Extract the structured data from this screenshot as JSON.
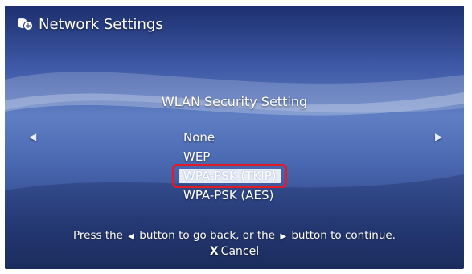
{
  "header": {
    "title": "Network Settings",
    "icon": "network-settings-icon"
  },
  "main": {
    "heading": "WLAN Security Setting",
    "nav_left_glyph": "◀",
    "nav_right_glyph": "▶",
    "options": [
      {
        "label": "None"
      },
      {
        "label": "WEP"
      },
      {
        "label": "WPA-PSK (TKIP)",
        "selected": true
      },
      {
        "label": "WPA-PSK (AES)"
      }
    ]
  },
  "footer": {
    "hint_prefix": "Press the",
    "hint_back_glyph": "◀",
    "hint_middle": "button to go back, or the",
    "hint_forward_glyph": "▶",
    "hint_suffix": "button to continue.",
    "cancel_glyph": "X",
    "cancel_label": "Cancel"
  },
  "colors": {
    "highlight_border": "#e21b24",
    "background_blue": "#3c57a4"
  }
}
